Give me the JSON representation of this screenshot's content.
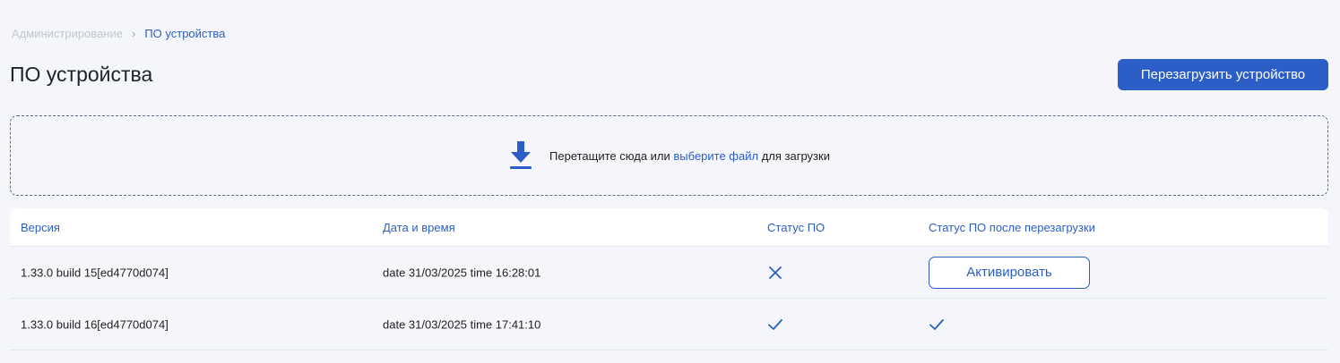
{
  "breadcrumb": {
    "parent": "Администрирование",
    "separator": "›",
    "current": "ПО устройства"
  },
  "page": {
    "title": "ПО устройства",
    "reboot_button": "Перезагрузить устройство"
  },
  "dropzone": {
    "icon": "download-icon",
    "text_before": "Перетащите сюда или ",
    "link": "выберите файл",
    "text_after": " для загрузки"
  },
  "table": {
    "headers": [
      "Версия",
      "Дата и время",
      "Статус ПО",
      "Статус ПО после перезагрузки"
    ],
    "rows": [
      {
        "version": "1.33.0 build 15[ed4770d074]",
        "datetime": "date 31/03/2025 time 16:28:01",
        "status": "cross-icon",
        "after_reboot_action": "Активировать"
      },
      {
        "version": "1.33.0 build 16[ed4770d074]",
        "datetime": "date 31/03/2025 time 17:41:10",
        "status": "check-icon",
        "after_reboot_status": "check-icon"
      }
    ]
  },
  "colors": {
    "accent": "#2b5fc7",
    "background": "#f4f6fb",
    "breadcrumb_muted": "#c3c7ce"
  }
}
